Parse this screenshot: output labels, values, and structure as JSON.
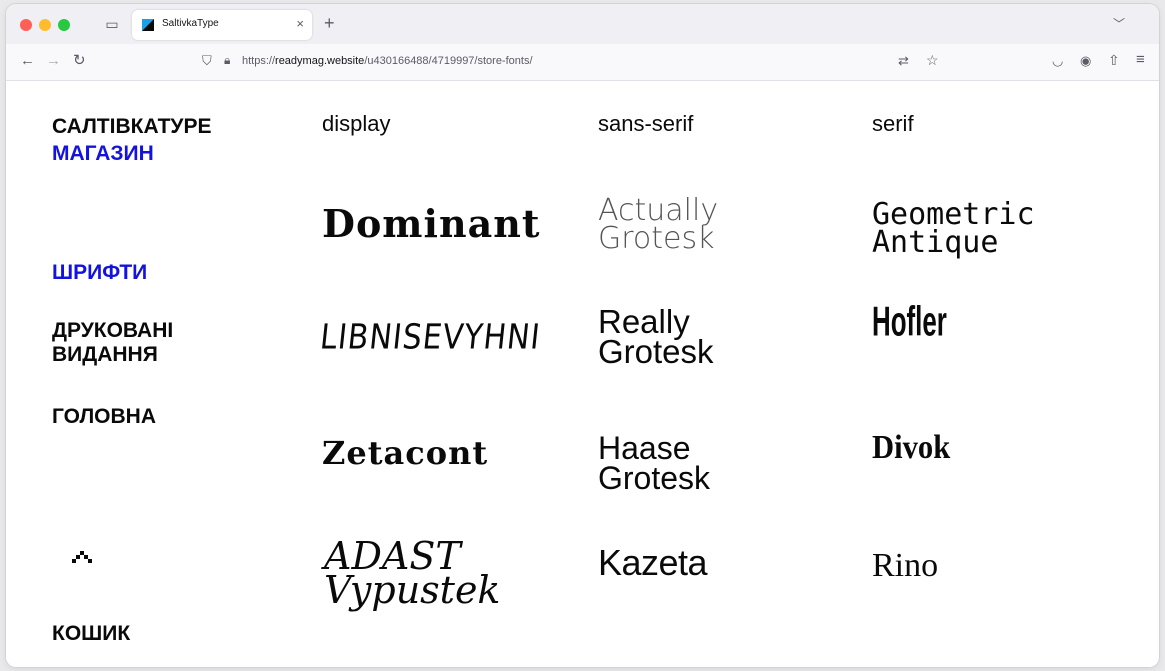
{
  "browser": {
    "tab_title": "SaltivkaType",
    "tab_close": "×",
    "new_tab": "+",
    "url_prefix": "https://",
    "url_host": "readymag.website",
    "url_path": "/u430166488/4719997/store-fonts/"
  },
  "sidebar": {
    "brand": "САЛТІВКАТУРЕ",
    "shop": "МАГАЗИН",
    "fonts": "ШРИФТИ",
    "print": "ДРУКОВАНІ ВИДАННЯ",
    "home": "ГОЛОВНА",
    "cart": "КОШИК"
  },
  "columns": {
    "display": {
      "heading": "display",
      "fonts": [
        "Dominant",
        "LIBNISEVYHNI",
        "Zetacont",
        "ADAST Vypustek"
      ]
    },
    "sans": {
      "heading": "sans-serif",
      "fonts": [
        "Actually Grotesk",
        "Really Grotesk",
        "Haase Grotesk",
        "Kazeta"
      ]
    },
    "serif": {
      "heading": "serif",
      "fonts": [
        "Geometric Antique",
        "Hofler",
        "Divok",
        "Rino"
      ]
    }
  },
  "colors": {
    "accent_blue": "#1313e0",
    "text": "#0a0a0a"
  }
}
